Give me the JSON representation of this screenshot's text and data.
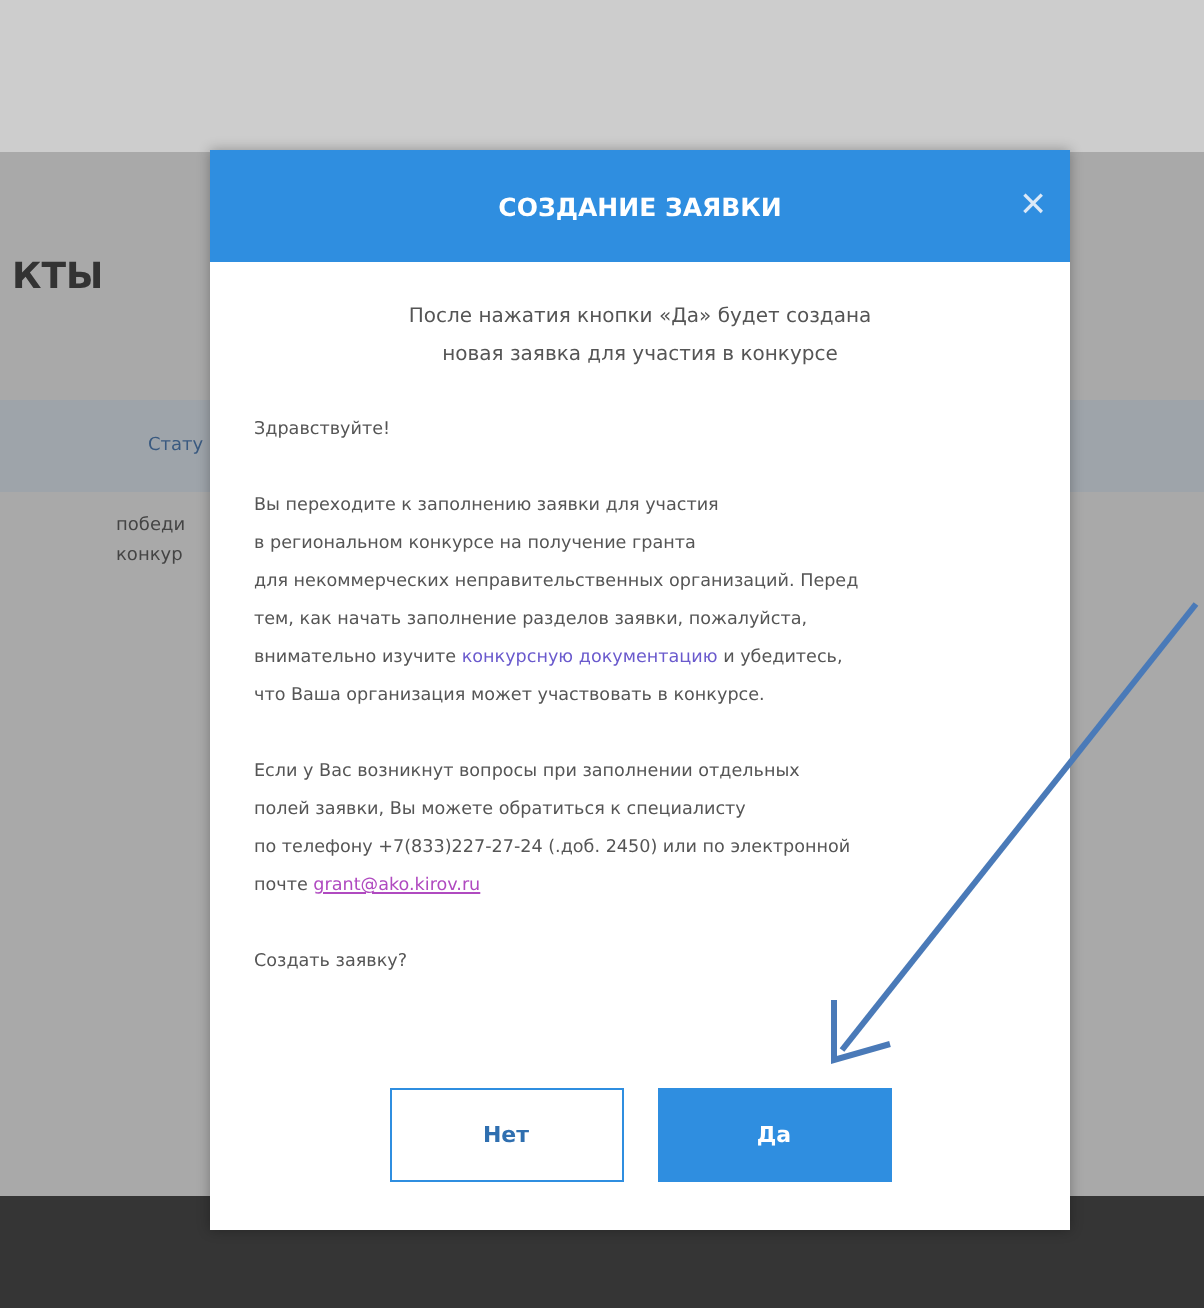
{
  "background": {
    "heading": "КТЫ",
    "table": {
      "column_1": "Стату",
      "cells": [
        "победи\nконкур"
      ]
    }
  },
  "dialog": {
    "title": "СОЗДАНИЕ ЗАЯВКИ",
    "close": "×",
    "intro": "После нажатия кнопки «Да» будет создана\nновая заявка для участия в конкурсе",
    "greeting": "Здравствуйте!",
    "paragraph": {
      "before": "Вы переходите к заполнению заявки для участия\nв региональном конкурсе на получение гранта\nдля некоммерческих неправительственных организаций. Перед\nтем, как начать заполнение разделов заявки, пожалуйста,\nвнимательно изучите ",
      "link": "конкурсную документацию",
      "after": " и убедитесь,\nчто Ваша организация может участвовать в конкурсе."
    },
    "contact": {
      "before": "Если у Вас возникнут вопросы при заполнении отдельных\nполей заявки, Вы можете обратиться к специалисту\nпо телефону +7(833)227-27-24 (.доб. 2450) или по электронной\nпочте ",
      "link": "grant@ako.kirov.ru"
    },
    "question": "Создать заявку?",
    "buttons": [
      {
        "label": "Нет",
        "kind": "secondary"
      },
      {
        "label": "Да",
        "kind": "primary"
      }
    ]
  }
}
